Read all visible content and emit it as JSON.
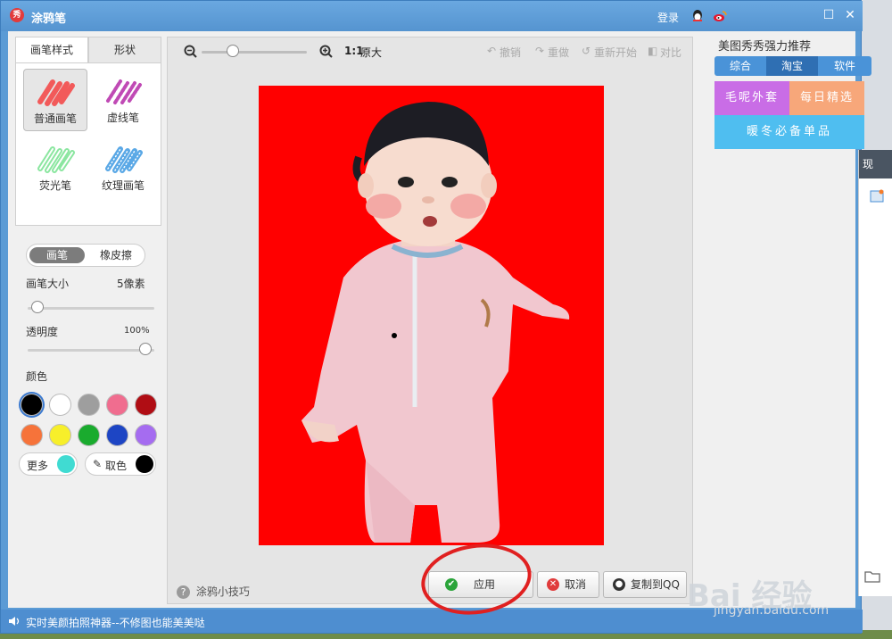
{
  "window": {
    "title": "涂鸦笔",
    "login": "登录"
  },
  "left": {
    "tabs": [
      "画笔样式",
      "形状"
    ],
    "brushes": [
      "普通画笔",
      "虚线笔",
      "荧光笔",
      "纹理画笔"
    ],
    "mode": {
      "brush": "画笔",
      "eraser": "橡皮擦"
    },
    "size_label": "画笔大小",
    "size_value": "5像素",
    "opacity_label": "透明度",
    "opacity_value": "100%",
    "color_label": "颜色",
    "swatches": [
      "#000000",
      "#ffffff",
      "#9e9e9e",
      "#f06d8f",
      "#b00d14",
      "#f6733a",
      "#f7ef2a",
      "#1aab2e",
      "#1d45c4",
      "#a56cf0"
    ],
    "more_label": "更多",
    "more_color": "#40dbd2",
    "pick_label": "取色",
    "pick_color": "#000000"
  },
  "toolbar": {
    "zoom_ratio": "1:1",
    "original": "原大",
    "undo": "撤销",
    "redo": "重做",
    "restart": "重新开始",
    "compare": "对比"
  },
  "bottom": {
    "tips": "涂鸦小技巧",
    "apply": "应用",
    "cancel": "取消",
    "copy_to_qq": "复制到QQ"
  },
  "right": {
    "title": "美图秀秀强力推荐",
    "tabs": [
      "综合",
      "淘宝",
      "软件"
    ],
    "promo1": "毛呢外套",
    "promo2": "每日精选",
    "promo3": "暖冬必备单品"
  },
  "status": {
    "text": "实时美颜拍照神器--不修图也能美美哒"
  },
  "side": {
    "head": "现"
  },
  "watermark": {
    "brand": "Bai 经验",
    "url": "jingyan.baidu.com"
  }
}
